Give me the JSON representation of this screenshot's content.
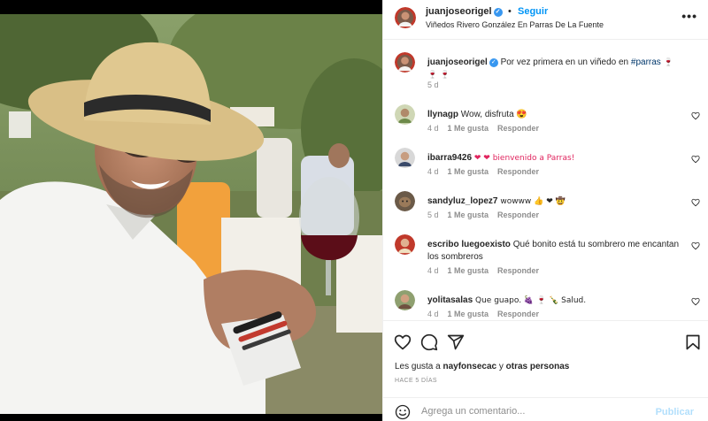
{
  "post": {
    "author": "juanjoseorigel",
    "follow_label": "Seguir",
    "dot": "•",
    "location": "Viñedos Rivero González En Parras De La Fuente",
    "caption_author": "juanjoseorigel",
    "caption_text": " Por vez primera en un viñedo en ",
    "caption_tag": "#parras",
    "caption_emojis": " 🍷 🍷 🍷",
    "caption_age": "5 d",
    "more_label": "•••"
  },
  "comments": [
    {
      "user": "llynagp",
      "text": " Wow, disfruta 😍",
      "age": "4 d",
      "likes": "1 Me gusta",
      "reply": "Responder"
    },
    {
      "user": "ibarra9426",
      "text": " ❤ ❤ bienvenido a Parras!",
      "age": "4 d",
      "likes": "1 Me gusta",
      "reply": "Responder"
    },
    {
      "user": "sandyluz_lopez7",
      "text": " wowww 👍 ❤ 🤠",
      "age": "5 d",
      "likes": "1 Me gusta",
      "reply": "Responder"
    },
    {
      "user": "escribo luegoexisto",
      "text": " Qué bonito está tu sombrero me encantan los sombreros",
      "age": "4 d",
      "likes": "1 Me gusta",
      "reply": "Responder"
    },
    {
      "user": "yolitasalas",
      "text": " Que guapo. 🍇 🍷 🍾 Salud.",
      "age": "4 d",
      "likes": "1 Me gusta",
      "reply": "Responder"
    }
  ],
  "likes_line": {
    "prefix": "Les gusta a ",
    "user": "nayfonsecac",
    "middle": " y ",
    "others": "otras personas"
  },
  "time_ago": "HACE 5 DÍAS",
  "composer": {
    "placeholder": "Agrega un comentario...",
    "publish": "Publicar"
  },
  "icons": [
    "heart-icon",
    "comment-icon",
    "share-icon",
    "bookmark-icon",
    "emoji-icon",
    "verified-icon",
    "more-icon"
  ],
  "colors": {
    "link": "#0095f6",
    "publish_disabled": "#b2dffc",
    "verified": "#3897f0",
    "secondary": "#8e8e8e"
  }
}
